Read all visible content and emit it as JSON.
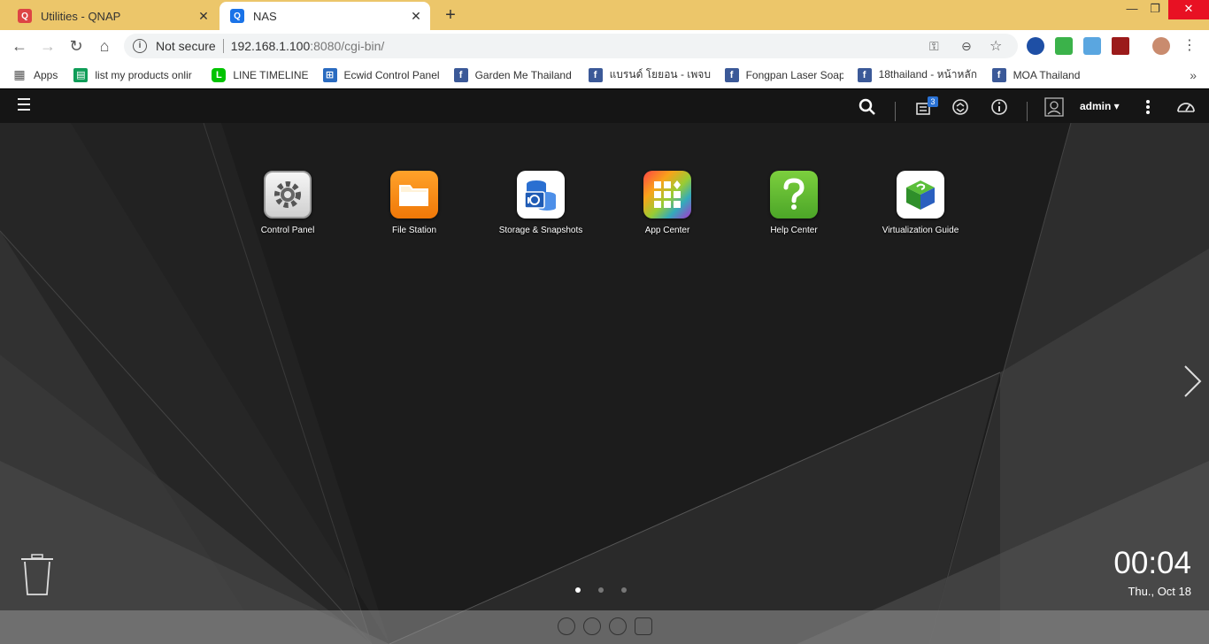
{
  "browser": {
    "tabs": [
      {
        "title": "Utilities - QNAP",
        "favicon": "qnap-icon",
        "active": false
      },
      {
        "title": "NAS",
        "favicon": "qnap-icon",
        "active": true
      }
    ],
    "new_tab_label": "+",
    "address": {
      "security_label": "Not secure",
      "host": "192.168.1.100",
      "port": ":8080",
      "path": "/cgi-bin/"
    },
    "bookmarks": [
      {
        "label": "Apps",
        "icon": "apps-grid-icon"
      },
      {
        "label": "list my products onlir",
        "icon": "sheets-icon"
      },
      {
        "label": "LINE TIMELINE",
        "icon": "line-icon"
      },
      {
        "label": "Ecwid Control Panel",
        "icon": "cart-icon"
      },
      {
        "label": "Garden Me Thailand",
        "icon": "facebook-icon"
      },
      {
        "label": "แบรนด์ โยยอน - เพจบริษั",
        "icon": "facebook-icon"
      },
      {
        "label": "Fongpan Laser Soap",
        "icon": "facebook-icon"
      },
      {
        "label": "18thailand - หน้าหลัก",
        "icon": "facebook-icon"
      },
      {
        "label": "MOA Thailand",
        "icon": "facebook-icon"
      }
    ],
    "more_bookmarks": "»"
  },
  "qts": {
    "header": {
      "notification_count": "3",
      "user": "admin ▾"
    },
    "apps": [
      {
        "label": "Control Panel",
        "icon": "gear-icon"
      },
      {
        "label": "File Station",
        "icon": "folder-icon"
      },
      {
        "label": "Storage & Snapshots",
        "icon": "storage-icon"
      },
      {
        "label": "App Center",
        "icon": "app-grid-icon"
      },
      {
        "label": "Help Center",
        "icon": "question-icon"
      },
      {
        "label": "Virtualization Guide",
        "icon": "cube-icon"
      }
    ],
    "clock": {
      "time": "00:04",
      "date": "Thu., Oct 18"
    },
    "pages": {
      "total": 3,
      "current": 1
    }
  },
  "colors": {
    "tabbar": "#ecc66a",
    "qts_header": "#151515",
    "desktop_bg": "#1b1b1b",
    "file_station": "#f58a0b",
    "help_center": "#5fb832",
    "accent_blue": "#2a72d5"
  }
}
